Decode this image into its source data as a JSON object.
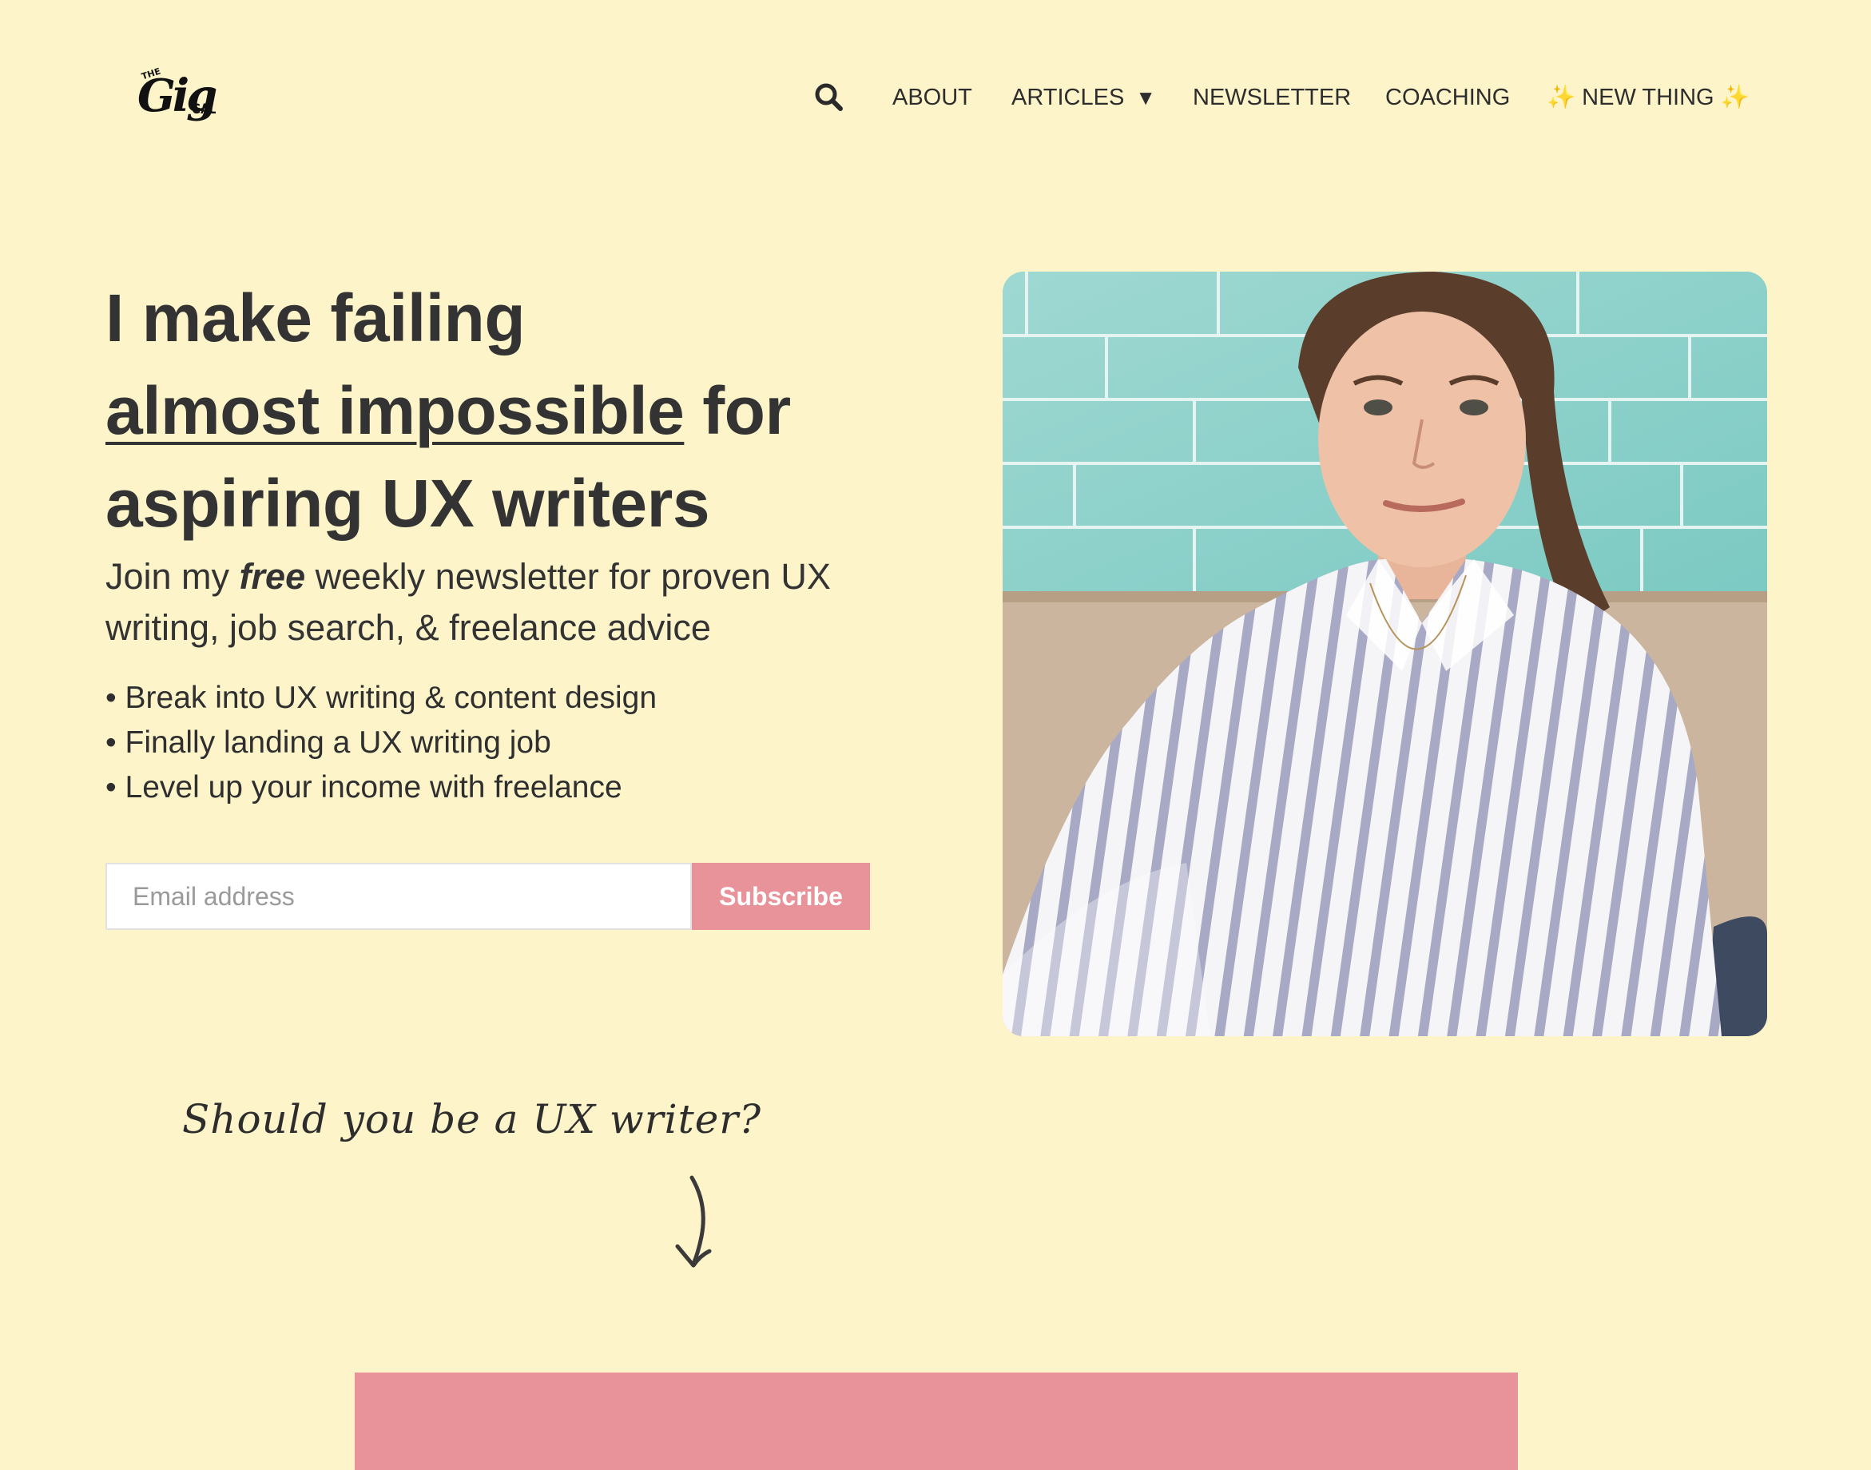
{
  "brand": {
    "logo_the": "THE",
    "logo_gig": "Gig",
    "logo_gal": "GAL",
    "logo_icon": "the-gig-gal-logo"
  },
  "nav": {
    "search_icon": "search-icon",
    "items": [
      {
        "label": "ABOUT"
      },
      {
        "label": "ARTICLES",
        "caret": "▼"
      },
      {
        "label": "NEWSLETTER"
      },
      {
        "label": "COACHING"
      },
      {
        "label": "NEW THING",
        "sparkle": "✨"
      }
    ]
  },
  "hero": {
    "headline_line1": "I make failing",
    "headline_underlined": "almost impossible",
    "headline_for": " for",
    "headline_line3": "aspiring UX writers",
    "subhead_before": "Join my ",
    "subhead_emphasis": "free",
    "subhead_after": " weekly newsletter for proven UX writing, job search, & freelance advice",
    "bullets": [
      "Break into UX writing & content design",
      "Finally landing a UX writing job",
      "Level up your income with freelance"
    ],
    "email_placeholder": "Email address",
    "subscribe_label": "Subscribe"
  },
  "prompt": {
    "text": "Should you be a UX writer?",
    "arrow_icon": "arrow-down-icon"
  },
  "colors": {
    "background": "#fdf4ca",
    "text": "#333333",
    "accent_pink": "#e8939a",
    "sparkle": "#f2c64a"
  }
}
